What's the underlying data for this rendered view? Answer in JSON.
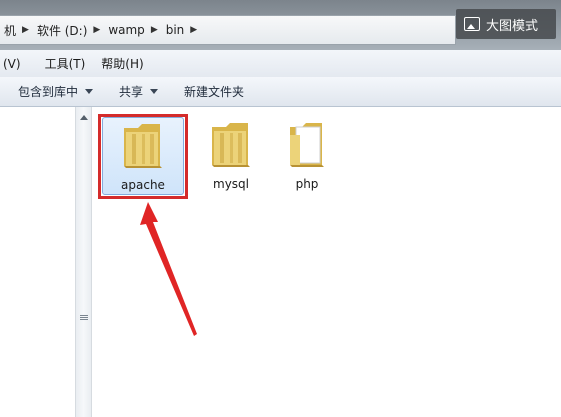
{
  "address_bar": {
    "crumbs": [
      "机",
      "软件 (D:)",
      "wamp",
      "bin"
    ]
  },
  "overlay": {
    "big_image_mode_label": "大图模式"
  },
  "menubar": {
    "items": [
      "(V)",
      "工具(T)",
      "帮助(H)"
    ]
  },
  "toolbar": {
    "include_in_library": "包含到库中",
    "share": "共享",
    "new_folder": "新建文件夹"
  },
  "folders": [
    {
      "name": "apache",
      "selected": true,
      "icon": "folder-icon"
    },
    {
      "name": "mysql",
      "selected": false,
      "icon": "folder-icon"
    },
    {
      "name": "php",
      "selected": false,
      "icon": "folder-open-icon"
    }
  ],
  "annotation": {
    "color": "#d42b2b"
  }
}
